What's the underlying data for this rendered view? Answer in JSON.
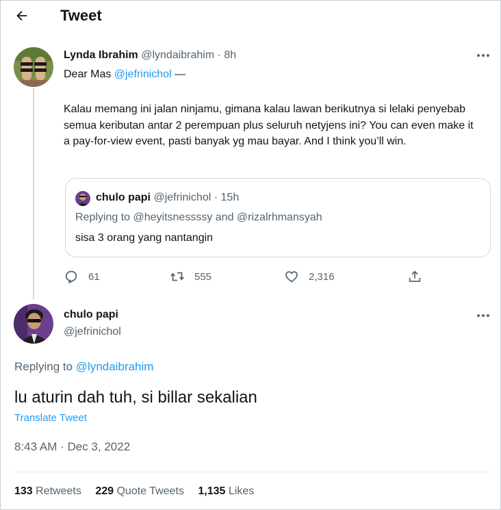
{
  "header": {
    "title": "Tweet"
  },
  "tweet1": {
    "author_name": "Lynda Ibrahim",
    "author_handle": "@lyndaibrahim",
    "separator": "·",
    "time": "8h",
    "greeting_prefix": "Dear Mas ",
    "greeting_mention": "@jefrinichol",
    "greeting_suffix": " —",
    "body": "Kalau memang ini jalan ninjamu, gimana kalau lawan berikutnya si lelaki penyebab semua keributan antar 2 perempuan plus seluruh netyjens ini? You can even make it a pay-for-view event, pasti banyak yg mau bayar. And I think you’ll win.",
    "quote": {
      "author_name": "chulo papi",
      "author_handle": "@jefrinichol",
      "separator": "·",
      "time": "15h",
      "replying_text": "Replying to @heyitsnessssy and @rizalrhmansyah",
      "text": "sisa 3 orang yang nantangin"
    },
    "actions": {
      "replies": "61",
      "retweets": "555",
      "likes": "2,316"
    }
  },
  "tweet2": {
    "author_name": "chulo papi",
    "author_handle": "@jefrinichol",
    "replying_prefix": "Replying to ",
    "replying_mention": "@lyndaibrahim",
    "text": "lu aturin dah tuh, si billar sekalian",
    "translate_label": "Translate Tweet",
    "timestamp": "8:43 AM · Dec 3, 2022",
    "stats": {
      "retweets_count": "133",
      "retweets_label": "Retweets",
      "quotes_count": "229",
      "quotes_label": "Quote Tweets",
      "likes_count": "1,135",
      "likes_label": "Likes"
    }
  },
  "colors": {
    "accent": "#1d9bf0",
    "text_primary": "#0f1419",
    "text_secondary": "#536471",
    "border": "#cfd9de"
  },
  "icons": [
    "back-arrow-icon",
    "more-icon",
    "reply-icon",
    "retweet-icon",
    "like-icon",
    "share-icon"
  ]
}
